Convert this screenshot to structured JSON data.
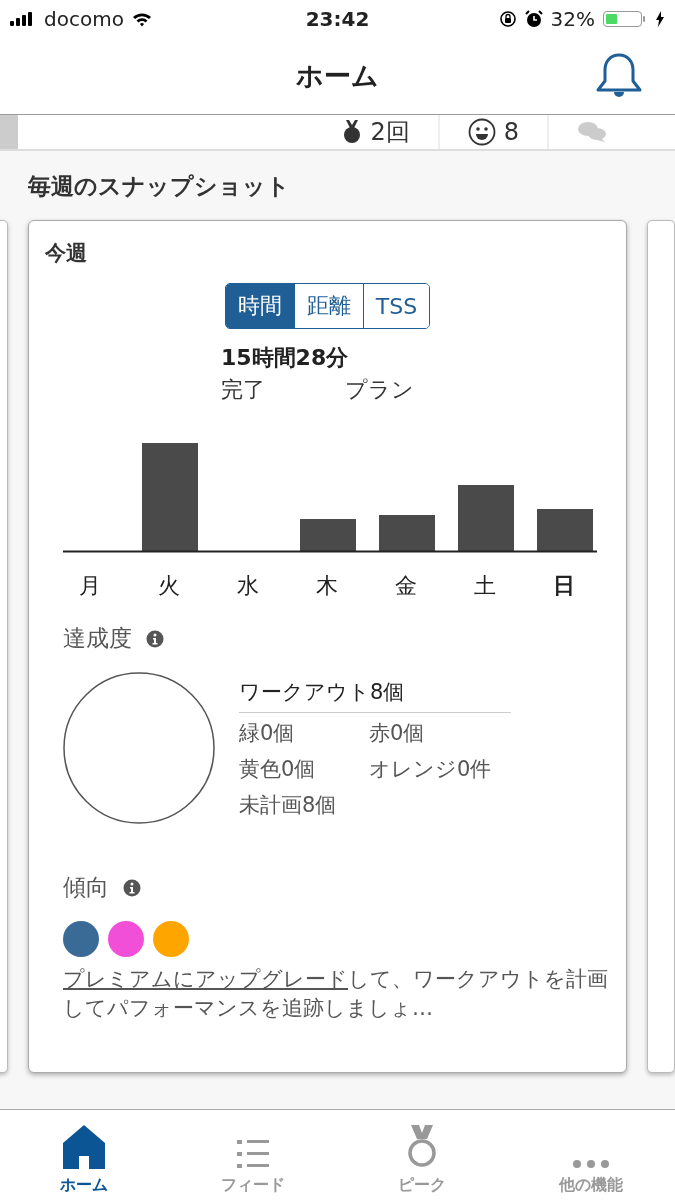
{
  "status_bar": {
    "carrier": "docomo",
    "time": "23:42",
    "battery": "32%"
  },
  "header": {
    "title": "ホーム"
  },
  "stats_strip": {
    "medals": "2回",
    "smiles": "8"
  },
  "section_title": "毎週のスナップショット",
  "card": {
    "title": "今週",
    "segments": [
      {
        "label": "時間",
        "selected": true
      },
      {
        "label": "距離",
        "selected": false
      },
      {
        "label": "TSS",
        "selected": false
      }
    ],
    "total": "15時間28分",
    "completed_label": "完了",
    "plan_label": "プラン",
    "days": [
      {
        "label": "月",
        "today": false
      },
      {
        "label": "火",
        "today": false
      },
      {
        "label": "水",
        "today": false
      },
      {
        "label": "木",
        "today": false
      },
      {
        "label": "金",
        "today": false
      },
      {
        "label": "土",
        "today": false
      },
      {
        "label": "日",
        "today": true
      }
    ],
    "compliance": {
      "title": "達成度",
      "workouts": "ワークアウト8個",
      "counts": [
        "緑0個",
        "赤0個",
        "黄色0個",
        "オレンジ0件",
        "未計画8個"
      ]
    },
    "trend": {
      "title": "傾向",
      "dots": [
        {
          "color": "#3a6b97"
        },
        {
          "color": "#f24fd8"
        },
        {
          "color": "#ffa500"
        }
      ],
      "link": "プレミアムにアップグレード",
      "text": "して、ワークアウトを計画してパフォーマンスを追跡しましょ…"
    }
  },
  "tabs": [
    {
      "label": "ホーム",
      "selected": true,
      "kind": "home"
    },
    {
      "label": "フィード",
      "selected": false,
      "kind": "feed"
    },
    {
      "label": "ピーク",
      "selected": false,
      "kind": "peak"
    },
    {
      "label": "他の機能",
      "selected": false,
      "kind": "more"
    }
  ]
}
